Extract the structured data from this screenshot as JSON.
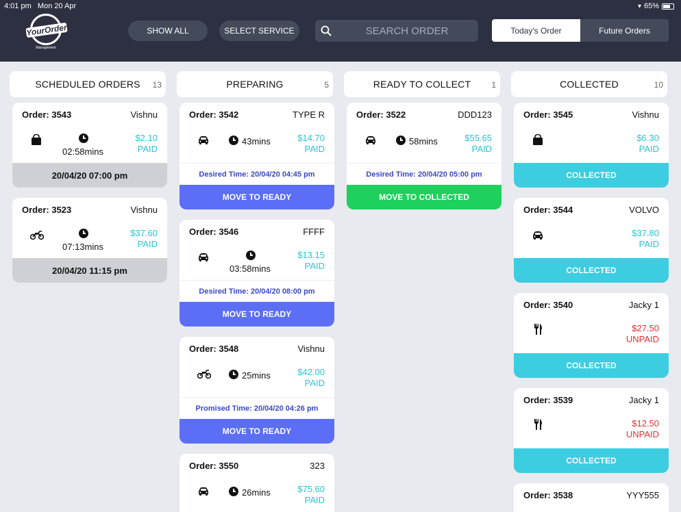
{
  "status_bar": {
    "time": "4:01 pm",
    "date": "Mon 20 Apr",
    "battery": "65%"
  },
  "logo": {
    "text": "YourOrder",
    "subtitle": "Management"
  },
  "toolbar": {
    "show_all": "SHOW ALL",
    "select_service": "SELECT SERVICE"
  },
  "search": {
    "placeholder": "SEARCH ORDER"
  },
  "tabs": {
    "today": "Today's Order",
    "future": "Future Orders",
    "active": "today"
  },
  "colors": {
    "paid": "#28c3d6",
    "unpaid": "#e0302f",
    "ready_button": "#5b6ef5",
    "collect_button": "#1ed05c",
    "collected_button": "#3ccde0",
    "topbar": "#2c3040"
  },
  "columns": {
    "scheduled": {
      "title": "SCHEDULED ORDERS",
      "count": "13",
      "orders": [
        {
          "order": "Order: 3543",
          "customer": "Vishnu",
          "service_icon": "bag-icon",
          "duration": "02:58mins",
          "price": "$2.10",
          "payment": "PAID",
          "footer": "20/04/20 07:00 pm"
        },
        {
          "order": "Order: 3523",
          "customer": "Vishnu",
          "service_icon": "motorbike-icon",
          "duration": "07:13mins",
          "price": "$37.60",
          "payment": "PAID",
          "footer": "20/04/20 11:15 pm"
        }
      ]
    },
    "preparing": {
      "title": "PREPARING",
      "count": "5",
      "orders": [
        {
          "order": "Order: 3542",
          "customer": "TYPE R",
          "service_icon": "car-icon",
          "duration": "43mins",
          "price": "$14.70",
          "payment": "PAID",
          "desired": "Desired Time: 20/04/20 04:45 pm",
          "action": "MOVE TO READY"
        },
        {
          "order": "Order: 3546",
          "customer": "FFFF",
          "service_icon": "car-icon",
          "duration": "03:58mins",
          "price": "$13.15",
          "payment": "PAID",
          "desired": "Desired Time: 20/04/20 08:00 pm",
          "action": "MOVE TO READY"
        },
        {
          "order": "Order: 3548",
          "customer": "Vishnu",
          "service_icon": "motorbike-icon",
          "duration": "25mins",
          "price": "$42.00",
          "payment": "PAID",
          "desired": "Promised Time: 20/04/20 04:26 pm",
          "action": "MOVE TO READY"
        },
        {
          "order": "Order: 3550",
          "customer": "323",
          "service_icon": "car-icon",
          "duration": "26mins",
          "price": "$75.60",
          "payment": "PAID"
        }
      ]
    },
    "ready": {
      "title": "READY TO COLLECT",
      "count": "1",
      "orders": [
        {
          "order": "Order: 3522",
          "customer": "DDD123",
          "service_icon": "car-icon",
          "duration": "58mins",
          "price": "$55.65",
          "payment": "PAID",
          "desired": "Desired Time: 20/04/20 05:00 pm",
          "action": "MOVE TO COLLECTED"
        }
      ]
    },
    "collected": {
      "title": "COLLECTED",
      "count": "10",
      "orders": [
        {
          "order": "Order: 3545",
          "customer": "Vishnu",
          "service_icon": "bag-icon",
          "price": "$6.30",
          "payment": "PAID",
          "action": "COLLECTED"
        },
        {
          "order": "Order: 3544",
          "customer": "VOLVO",
          "service_icon": "car-icon",
          "price": "$37.80",
          "payment": "PAID",
          "action": "COLLECTED"
        },
        {
          "order": "Order: 3540",
          "customer": "Jacky 1",
          "service_icon": "cutlery-icon",
          "price": "$27.50",
          "payment": "UNPAID",
          "action": "COLLECTED"
        },
        {
          "order": "Order: 3539",
          "customer": "Jacky 1",
          "service_icon": "cutlery-icon",
          "price": "$12.50",
          "payment": "UNPAID",
          "action": "COLLECTED"
        },
        {
          "order": "Order: 3538",
          "customer": "YYY555"
        }
      ]
    }
  }
}
